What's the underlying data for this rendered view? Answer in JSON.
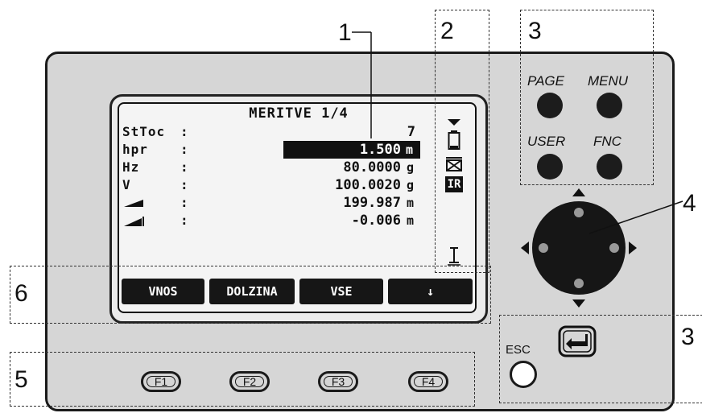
{
  "display": {
    "title": "MERITVE 1/4",
    "rows": [
      {
        "label": "StToc",
        "value": "7",
        "unit": ""
      },
      {
        "label": "hpr",
        "value": "1.500",
        "unit": "m"
      },
      {
        "label": "Hz",
        "value": "80.0000",
        "unit": "g"
      },
      {
        "label": "V",
        "value": "100.0020",
        "unit": "g"
      },
      {
        "label": "",
        "value": "199.987",
        "unit": "m"
      },
      {
        "label": "",
        "value": "-0.006",
        "unit": "m"
      }
    ],
    "ir_badge": "IR",
    "softkeys": [
      "VNOS",
      "DOLZINA",
      "VSE",
      "↓"
    ]
  },
  "buttons": {
    "page": "PAGE",
    "menu": "MENU",
    "user": "USER",
    "fnc": "FNC",
    "esc": "ESC",
    "f1": "F1",
    "f2": "F2",
    "f3": "F3",
    "f4": "F4"
  },
  "callouts": {
    "c1": "1",
    "c2": "2",
    "c3_top": "3",
    "c3_right": "3",
    "c4": "4",
    "c5": "5",
    "c6": "6"
  },
  "icons": {
    "battery": "battery-icon",
    "reflector": "reflector-icon",
    "level": "level-icon",
    "enter": "enter-icon",
    "navigation": "nav-pad-icon"
  }
}
